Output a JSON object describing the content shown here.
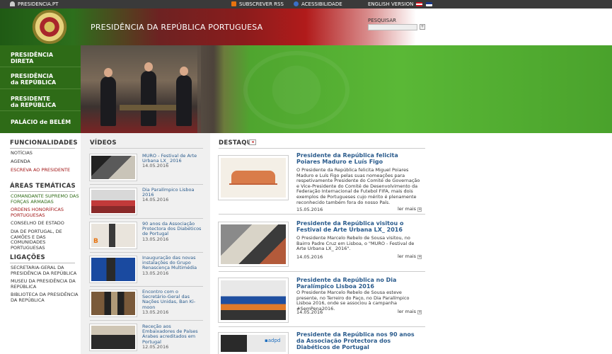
{
  "topbar": {
    "site": "PRESIDENCIA.PT",
    "rss": "SUBSCREVER RSS",
    "accessibility": "ACESSIBILIDADE",
    "english": "ENGLISH VERSION"
  },
  "header": {
    "title": "PRESIDÊNCIA DA REPÚBLICA PORTUGUESA",
    "search_label": "PESQUISAR",
    "search_placeholder": "",
    "search_button": "+"
  },
  "nav": [
    {
      "line1": "PRESIDÊNCIA",
      "line2": "DIRETA"
    },
    {
      "line1": "PRESIDÊNCIA",
      "line2": "da REPÚBLICA"
    },
    {
      "line1": "PRESIDENTE",
      "line2": "da REPÚBLICA"
    },
    {
      "line1": "PALÁCIO de BELÉM",
      "line2": ""
    }
  ],
  "left": {
    "funcionalidades_title": "FUNCIONALIDADES",
    "funcionalidades": [
      "NOTÍCIAS",
      "AGENDA",
      "ESCREVA AO PRESIDENTE"
    ],
    "areas_title": "ÁREAS TEMÁTICAS",
    "areas": [
      "COMANDANTE SUPREMO DAS FORÇAS ARMADAS",
      "ORDENS HONORÍFICAS PORTUGUESAS",
      "CONSELHO DE ESTADO",
      "DIA DE PORTUGAL, DE CAMÕES E DAS COMUNIDADES PORTUGUESAS"
    ],
    "ligacoes_title": "LIGAÇÕES",
    "ligacoes": [
      "SECRETARIA-GERAL DA PRESIDÊNCIA DA REPÚBLICA",
      "MUSEU DA PRESIDÊNCIA DA REPÚBLICA",
      "BIBLIOTECA DA PRESIDÊNCIA DA REPÚBLICA"
    ]
  },
  "videos": {
    "title": "VÍDEOS",
    "items": [
      {
        "title": "MURO - Festival de Arte Urbana LX_ 2016",
        "date": "14.05.2016"
      },
      {
        "title": "Dia Paralímpico Lisboa 2016",
        "date": "14.05.2016"
      },
      {
        "title": "90 anos da Associação Protectora dos Diabéticos de Portugal",
        "date": "13.05.2016"
      },
      {
        "title": "Inauguração das novas instalações do Grupo Renascença Multimédia",
        "date": "13.05.2016"
      },
      {
        "title": "Encontro com o Secretário-Geral das Nações Unidas, Ban Ki-moon",
        "date": "13.05.2016"
      },
      {
        "title": "Receção aos Embaixadores de Países Árabes acreditados em Portugal",
        "date": "12.05.2016"
      }
    ]
  },
  "destaque": {
    "title": "DESTAQUE",
    "read_more": "ler mais",
    "items": [
      {
        "title": "Presidente da República felicita Poiares Maduro e Luís Figo",
        "body": "O Presidente da República felicita Miguel Poiares Maduro e Luís Figo pelas suas nomeações para respetivamente Presidente do Comité de Governação e Vice-Presidente do Comité de Desenvolvimento da Federação Internacional de Futebol FIFA, mais dois exemplos de Portugueses cujo mérito é plenamente reconhecido também fora do nosso País.",
        "date": "15.05.2016"
      },
      {
        "title": "Presidente da República visitou o Festival de Arte Urbana LX_ 2016",
        "body": "O Presidente Marcelo Rebelo de Sousa visitou, no Bairro Padre Cruz em Lisboa, o \"MURO - Festival de Arte Urbana LX_ 2016\".",
        "date": "14.05.2016"
      },
      {
        "title": "Presidente da República no Dia Paralímpico Lisboa 2016",
        "body": "O Presidente Marcelo Rebelo de Sousa esteve presente, no Terreiro do Paço, no Dia Paralímpico Lisboa 2016, onde se associou à campanha #SemPena2016.",
        "date": "14.05.2016"
      },
      {
        "title": "Presidente da República nos 90 anos da Associação Protectora dos Diabéticos de Portugal",
        "body": "",
        "date": ""
      }
    ]
  }
}
